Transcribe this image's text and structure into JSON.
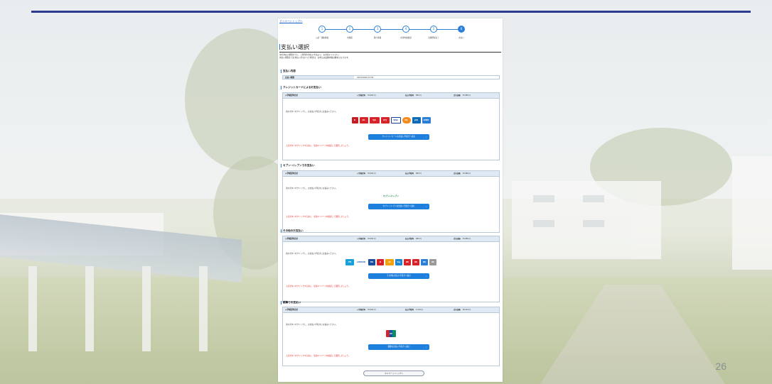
{
  "slide": {
    "number": "26"
  },
  "breadcrumb": "マイページ トップへ",
  "steps": [
    {
      "num": "1",
      "label": "入試・選抜情報"
    },
    {
      "num": "2",
      "label": "志願者"
    },
    {
      "num": "3",
      "label": "個人情報"
    },
    {
      "num": "4",
      "label": "志望内容確認"
    },
    {
      "num": "5",
      "label": "出願登録完了"
    },
    {
      "num": "6",
      "label": "支払い"
    }
  ],
  "page_title": "支払い選択",
  "notice_lines": [
    "次の支払い期限までに、ご希望の支払い方法より、お手続いください。",
    "支払い期限までお支払いがなかった場合は、お申込み出願内容は無効となります。"
  ],
  "summary": {
    "heading": "支払い内容",
    "label": "支払い期限",
    "value": "2023/10/09 23:59"
  },
  "methods": [
    {
      "heading": "クレジットカードによるお支払い",
      "name": "入学検定料合計",
      "fee_label": "入学検定料",
      "fee": "35,000 円",
      "charge_label": "払込手数料",
      "charge": "880 円",
      "total_label": "合計金額",
      "total": "35,880 円",
      "note": "次のボタンをクリックし、お支払い手続きにお進みください。",
      "logos": [
        {
          "name": "diners",
          "text": "D",
          "color": "#c41e24"
        },
        {
          "name": "jcb-red",
          "text": "DC",
          "color": "#d6242a"
        },
        {
          "name": "cards-red",
          "text": "VJA",
          "color": "#d6242a"
        },
        {
          "name": "ufj",
          "text": "UFJ",
          "color": "#d6242a"
        },
        {
          "name": "visa",
          "text": "VISA",
          "color": "#1a3f96"
        },
        {
          "name": "mastercard",
          "text": "MC",
          "color": "#f28b20"
        },
        {
          "name": "jcb",
          "text": "JCB",
          "color": "#0f6bb5"
        },
        {
          "name": "amex",
          "text": "AMEX",
          "color": "#2d7fd6"
        }
      ],
      "button": "クレジットカードお支払い手続きへ進む",
      "warn": "上記ボタンをクリックする前に、今週マイページを確認して選択しましょう。"
    },
    {
      "heading": "セブン-イレブンでお支払い",
      "name": "入学検定料合計",
      "fee_label": "入学検定料",
      "fee": "35,000 円",
      "charge_label": "払込手数料",
      "charge": "880 円",
      "total_label": "合計金額",
      "total": "35,880 円",
      "note": "次のボタンをクリックし、お支払い手続きにお進みください。",
      "logos": [
        {
          "name": "seven-eleven",
          "text": "セブン‐イレブン",
          "color": "#0e7f3f"
        }
      ],
      "button": "セブン‐イレブンお支払い手続きへ進む",
      "warn": "上記ボタンをクリックする前に、今週マイページを確認して選択しましょう。"
    },
    {
      "heading": "その他のお支払い",
      "name": "入学検定料合計",
      "fee_label": "入学検定料",
      "fee": "35,000 円",
      "charge_label": "払込手数料",
      "charge": "880 円",
      "total_label": "合計金額",
      "total": "35,880 円",
      "note": "次のボタンをクリックし、お支払い手続きにお進みください。",
      "logos": [
        {
          "name": "familymart",
          "text": "FM",
          "color": "#1a9fd8"
        },
        {
          "name": "lawson",
          "text": "LAWSON",
          "color": "#2160b0"
        },
        {
          "name": "ministop",
          "text": "MS",
          "color": "#1a4fa0"
        },
        {
          "name": "dailyyamazaki",
          "text": "D",
          "color": "#d6242a"
        },
        {
          "name": "seicomart",
          "text": "SC",
          "color": "#f1a20e"
        },
        {
          "name": "payeasy",
          "text": "Pay",
          "color": "#1e88d0"
        },
        {
          "name": "bank-a",
          "text": "BK",
          "color": "#d6242a"
        },
        {
          "name": "bank-b",
          "text": "BK",
          "color": "#d6242a"
        },
        {
          "name": "bank-c",
          "text": "BK",
          "color": "#2d7fd6"
        },
        {
          "name": "bank-d",
          "text": "BK",
          "color": "#999999"
        }
      ],
      "button": "その他お支払い手続きへ進む",
      "warn": "上記ボタンをクリックする前に、今週マイページを確認して選択しましょう。"
    },
    {
      "heading": "銀聯でお支払い",
      "name": "入学検定料合計",
      "fee_label": "入学検定料",
      "fee": "35,000 円",
      "charge_label": "払込手数料",
      "charge": "1,210 円",
      "total_label": "合計金額",
      "total": "36,210 円",
      "note": "次のボタンをクリックし、お支払い手続きにお進みください。",
      "logos": [
        {
          "name": "unionpay",
          "text": "UP",
          "color": "#d6242a"
        }
      ],
      "button": "銀聯お支払い手続きへ進む",
      "warn": "上記ボタンをクリックする前に、今週マイページを確認して選択しましょう。"
    }
  ],
  "back_button": "マイページ トップへ"
}
